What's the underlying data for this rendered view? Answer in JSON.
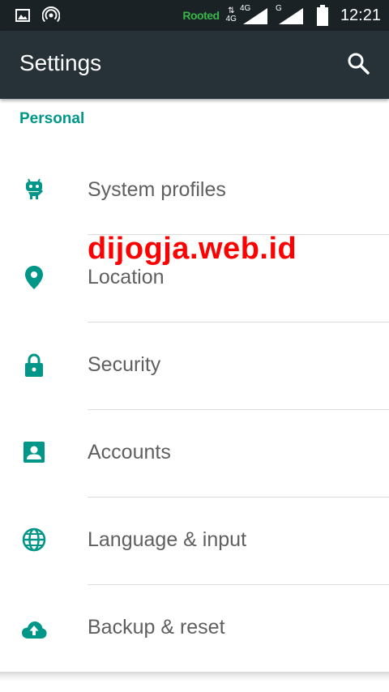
{
  "status_bar": {
    "rooted": "Rooted",
    "net1": "4G",
    "net1_top": "4G",
    "net2": "G",
    "time": "12:21"
  },
  "toolbar": {
    "title": "Settings"
  },
  "category": "Personal",
  "items": [
    {
      "label": "System profiles",
      "icon": "robot-icon"
    },
    {
      "label": "Location",
      "icon": "location-pin-icon"
    },
    {
      "label": "Security",
      "icon": "lock-icon"
    },
    {
      "label": "Accounts",
      "icon": "account-box-icon"
    },
    {
      "label": "Language & input",
      "icon": "globe-icon"
    },
    {
      "label": "Backup & reset",
      "icon": "cloud-upload-icon"
    }
  ],
  "watermark": "dijogja.web.id",
  "colors": {
    "accent": "#009688",
    "toolbar": "#263238",
    "statusbar": "#1b2226",
    "watermark": "#ff0000"
  }
}
